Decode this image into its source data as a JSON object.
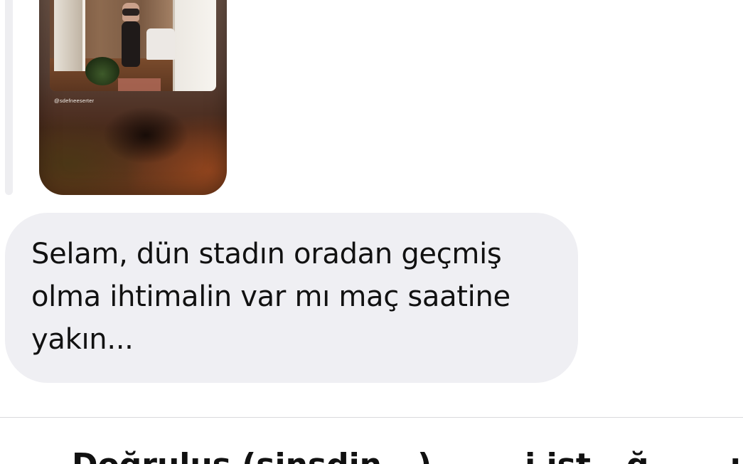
{
  "story": {
    "username": "@sdefneeserter",
    "thumbnail_icon": "shared-story-image"
  },
  "message": {
    "text": "Selam, dün stadın oradan geçmiş\nolma ihtimalin var mı maç saatine\nyakın..."
  },
  "bottom": {
    "caption": "Doğruluş (sinsdin...) ... ...i ist...ğ ... ..ı .."
  },
  "colors": {
    "bubble_background": "#efeff3",
    "page_background": "#ffffff",
    "text": "#111111"
  }
}
